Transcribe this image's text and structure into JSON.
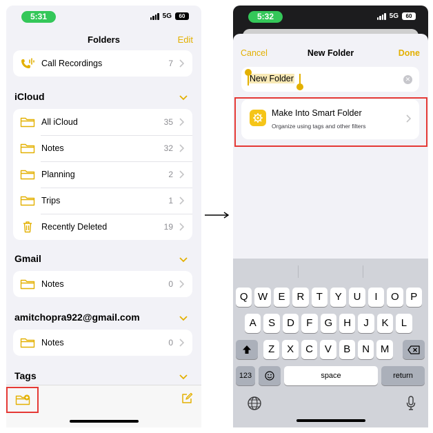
{
  "left": {
    "status": {
      "time": "5:31",
      "network": "5G",
      "battery": "60"
    },
    "nav": {
      "title": "Folders",
      "edit_label": "Edit"
    },
    "top_items": [
      {
        "label": "Call Recordings",
        "count": "7"
      }
    ],
    "sections": {
      "icloud": {
        "title": "iCloud",
        "items": [
          {
            "label": "All iCloud",
            "count": "35"
          },
          {
            "label": "Notes",
            "count": "32"
          },
          {
            "label": "Planning",
            "count": "2"
          },
          {
            "label": "Trips",
            "count": "1"
          },
          {
            "label": "Recently Deleted",
            "count": "19"
          }
        ]
      },
      "gmail": {
        "title": "Gmail",
        "items": [
          {
            "label": "Notes",
            "count": "0"
          }
        ]
      },
      "account": {
        "title": "amitchopra922@gmail.com",
        "items": [
          {
            "label": "Notes",
            "count": "0"
          }
        ]
      },
      "tags": {
        "title": "Tags"
      }
    }
  },
  "right": {
    "status": {
      "time": "5:32",
      "network": "5G",
      "battery": "60"
    },
    "sheet": {
      "cancel_label": "Cancel",
      "title": "New Folder",
      "done_label": "Done",
      "name_value": "New Folder",
      "smart_title": "Make Into Smart Folder",
      "smart_subtitle": "Organize using tags and other filters"
    },
    "keyboard": {
      "row1": [
        "Q",
        "W",
        "E",
        "R",
        "T",
        "Y",
        "U",
        "I",
        "O",
        "P"
      ],
      "row2": [
        "A",
        "S",
        "D",
        "F",
        "G",
        "H",
        "J",
        "K",
        "L"
      ],
      "row3": [
        "Z",
        "X",
        "C",
        "V",
        "B",
        "N",
        "M"
      ],
      "numbers_label": "123",
      "space_label": "space",
      "return_label": "return"
    }
  },
  "colors": {
    "accent": "#e3b000",
    "highlight": "#e53935",
    "status_pill": "#34c759",
    "folder_icon": "#e3b000"
  },
  "icons": {
    "call": "phone-waveform-icon",
    "folder": "folder-icon",
    "trash": "trash-icon",
    "new_folder": "folder-badge-plus-icon",
    "compose": "compose-icon",
    "smart": "gear-icon",
    "arrow": "right-arrow-icon"
  }
}
